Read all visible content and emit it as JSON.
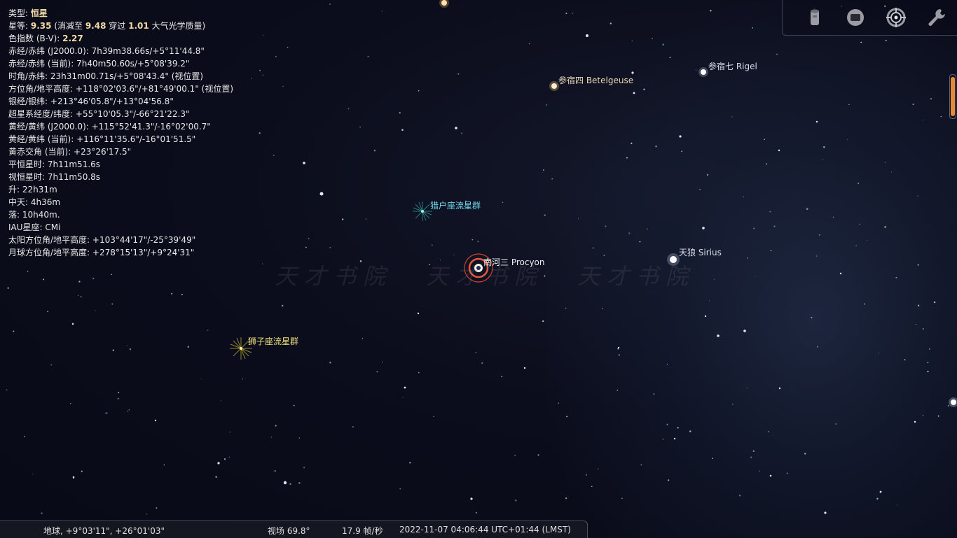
{
  "info_panel": {
    "type_label": "类型:",
    "type_value": "恒星",
    "magnitude_label": "星等:",
    "magnitude_value": "9.35",
    "magnitude_mid": "(消减至",
    "magnitude_ext": "9.48",
    "magnitude_through": "穿过",
    "airmass": "1.01",
    "magnitude_tail": "大气光学质量)",
    "color_index_label": "色指数 (B-V):",
    "color_index_value": "2.27",
    "lines": [
      "赤经/赤纬 (J2000.0): 7h39m38.66s/+5°11'44.8\"",
      "赤经/赤纬 (当前): 7h40m50.60s/+5°08'39.2\"",
      "时角/赤纬: 23h31m00.71s/+5°08'43.4\" (视位置)",
      "方位角/地平高度: +118°02'03.6\"/+81°49'00.1\" (视位置)",
      "银经/银纬: +213°46'05.8\"/+13°04'56.8\"",
      "超星系经度/纬度: +55°10'05.3\"/-66°21'22.3\"",
      "黄经/黄纬 (J2000.0): +115°52'41.3\"/-16°02'00.7\"",
      "黄经/黄纬 (当前): +116°11'35.6\"/-16°01'51.5\"",
      "黄赤交角 (当前): +23°26'17.5\"",
      "平恒星时: 7h11m51.6s",
      "视恒星时: 7h11m50.8s",
      "升: 22h31m",
      "中天: 4h36m",
      "落: 10h40m.",
      "IAU星座: CMi",
      "太阳方位角/地平高度: +103°44'17\"/-25°39'49\"",
      "月球方位角/地平高度: +278°15'13\"/+9°24'31\""
    ]
  },
  "sky_labels": {
    "betelgeuse": "参宿四 Betelgeuse",
    "rigel": "参宿七 Rigel",
    "orionids": "猎户座流星群",
    "procyon": "南河三 Procyon",
    "sirius": "天狼 Sirius",
    "leonids": "狮子座流星群"
  },
  "watermark": "天才书院",
  "toolbar": {
    "buttons": [
      "telescope-icon",
      "screen-icon",
      "target-icon",
      "wrench-icon"
    ]
  },
  "statusbar": {
    "location": "地球, +9°03'11\", +26°01'03\"",
    "fov": "视场 69.8°",
    "fps": "17.9 帧/秒",
    "datetime": "2022-11-07 04:06:44 UTC+01:44 (LMST)"
  },
  "colors": {
    "accent": "#e58a3b",
    "selection_ring": "#e2583a",
    "background": "#0b0d1c"
  }
}
